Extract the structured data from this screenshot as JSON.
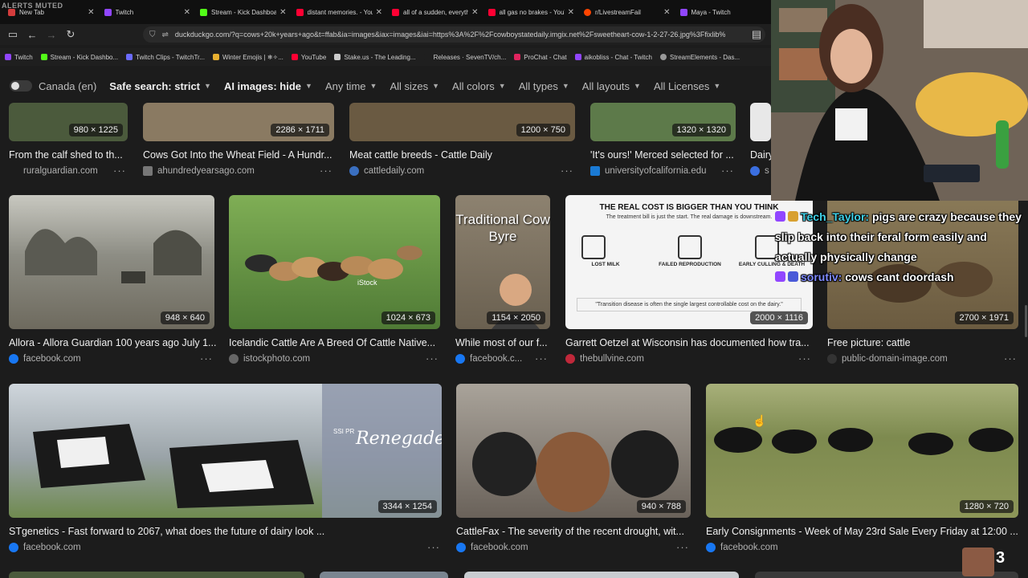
{
  "watermark": "ALERTS MUTED",
  "tabs": [
    {
      "title": "New Tab",
      "color": "#d43c3c"
    },
    {
      "title": "Twitch",
      "color": "#9146ff"
    },
    {
      "title": "Stream - Kick Dashboard",
      "color": "#53fc18"
    },
    {
      "title": "distant memories. - You",
      "color": "#ff0033"
    },
    {
      "title": "all of a sudden, everythi",
      "color": "#ff0033"
    },
    {
      "title": "all gas no brakes - YouT",
      "color": "#ff0033"
    },
    {
      "title": "r/LivestreamFail",
      "color": "#ff4500"
    },
    {
      "title": "Maya - Twitch",
      "color": "#9146ff"
    }
  ],
  "address": {
    "url": "duckduckgo.com/?q=cows+20k+years+ago&t=ffab&ia=images&iax=images&iai=https%3A%2F%2Fcowboystatedaily.imgix.net%2Fsweetheart-cow-1-2-27-26.jpg%3Ffixlib%"
  },
  "bookmarks": [
    {
      "label": "Twitch",
      "color": "#9146ff"
    },
    {
      "label": "Stream - Kick Dashbo...",
      "color": "#53fc18"
    },
    {
      "label": "Twitch Clips - TwitchTr...",
      "color": "#6b6bff"
    },
    {
      "label": "Winter Emojis | ❄✧...",
      "color": "#e8b030"
    },
    {
      "label": "YouTube",
      "color": "#ff0033"
    },
    {
      "label": "Stake.us - The Leading...",
      "color": "#cccccc"
    },
    {
      "label": "Releases · SevenTV/ch...",
      "color": "#1f1f1f"
    },
    {
      "label": "ProChat - Chat",
      "color": "#e0245e"
    },
    {
      "label": "aikobliss - Chat - Twitch",
      "color": "#9146ff"
    },
    {
      "label": "StreamElements - Das...",
      "color": "#999999"
    }
  ],
  "filters": {
    "region": "Canada (en)",
    "safe_search": "Safe search: strict",
    "ai_images": "AI images: hide",
    "time": "Any time",
    "sizes": "All sizes",
    "colors": "All colors",
    "types": "All types",
    "layouts": "All layouts",
    "licenses": "All Licenses"
  },
  "results": [
    {
      "title": "From the calf shed to th...",
      "source": "ruralguardian.com",
      "dims": "980 × 1225",
      "fav": "#2a4f7a",
      "img": "#4b5a3c"
    },
    {
      "title": "Cows Got Into the Wheat Field - A Hundr...",
      "source": "ahundredyearsago.com",
      "dims": "2286 × 1711",
      "fav": "#777777",
      "img": "#8a7a62"
    },
    {
      "title": "Meat cattle breeds - Cattle Daily",
      "source": "cattledaily.com",
      "dims": "1200 × 750",
      "fav": "#3a6fc0",
      "img": "#6a5a42"
    },
    {
      "title": "'It's ours!' Merced selected for ...",
      "source": "universityofcalifornia.edu",
      "dims": "1320 × 1320",
      "fav": "#1a7ad4",
      "img": "#5d7a4a"
    },
    {
      "title": "Dairy",
      "source": "s",
      "dims": "",
      "fav": "#3b6fe0",
      "img": "#e8e8e8"
    },
    {
      "title": "Allora - Allora Guardian 100 years ago July 1...",
      "source": "facebook.com",
      "dims": "948 × 640",
      "fav": "#1877f2",
      "img": "#8d8d84"
    },
    {
      "title": "Icelandic Cattle Are A Breed Of Cattle Native...",
      "source": "istockphoto.com",
      "dims": "1024 × 673",
      "fav": "#666666",
      "img": "#4f7a35"
    },
    {
      "title": "While most of our f...",
      "source": "facebook.c...",
      "dims": "1154 × 2050",
      "fav": "#1877f2",
      "img": "#7a7060"
    },
    {
      "title": "Garrett Oetzel at Wisconsin has documented how tra...",
      "source": "thebullvine.com",
      "dims": "2000 × 1116",
      "fav": "#c0283a",
      "img": "#f4f4f4"
    },
    {
      "title": "Free picture: cattle",
      "source": "public-domain-image.com",
      "dims": "2700 × 1971",
      "fav": "#333333",
      "img": "#6b5b40"
    },
    {
      "title": "STgenetics - Fast forward to 2067, what does the future of dairy look ...",
      "source": "facebook.com",
      "dims": "3344 × 1254",
      "fav": "#1877f2",
      "img": "#9aa3a8"
    },
    {
      "title": "CattleFax - The severity of the recent drought, wit...",
      "source": "facebook.com",
      "dims": "940 × 788",
      "fav": "#1877f2",
      "img": "#6a625a"
    },
    {
      "title": "Early Consignments - Week of May 23rd Sale Every Friday at 12:00 ...",
      "source": "facebook.com",
      "dims": "1280 × 720",
      "fav": "#1877f2",
      "img": "#7d8a4f"
    }
  ],
  "infographic": {
    "heading": "THE REAL COST IS BIGGER THAN YOU THINK",
    "sub": "The treatment bill is just the start. The real damage is downstream.",
    "cols": [
      "LOST MILK",
      "FAILED REPRODUCTION",
      "EARLY CULLING & DEATH"
    ],
    "quote": "\"Transition disease is often the single largest controllable cost on the dairy.\""
  },
  "image_text": {
    "traditional": "Traditional Cow Byre",
    "istock": "iStock",
    "renegade": "Renegade",
    "ssi": "SSI PR"
  },
  "chat": [
    {
      "user": "Tech_Taylor:",
      "message": "pigs are crazy because they slip back into their feral form easily and actually physically change"
    },
    {
      "user": "sorutiv:",
      "message": "cows cant doordash"
    }
  ],
  "viewers": "3"
}
